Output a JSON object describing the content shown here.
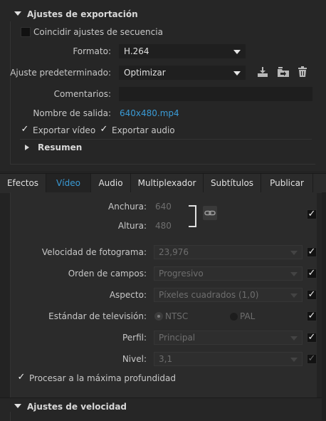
{
  "export_settings": {
    "section_title": "Ajustes de exportación",
    "match_sequence_label": "Coincidir ajustes de secuencia",
    "format_label": "Formato:",
    "format_value": "H.264",
    "preset_label": "Ajuste predeterminado:",
    "preset_value": "Optimizar",
    "comments_label": "Comentarios:",
    "comments_value": "",
    "output_name_label": "Nombre de salida:",
    "output_name_value": "640x480.mp4",
    "export_video_label": "Exportar vídeo",
    "export_audio_label": "Exportar audio",
    "summary_label": "Resumen"
  },
  "tabs": [
    {
      "label": "Efectos"
    },
    {
      "label": "Vídeo"
    },
    {
      "label": "Audio"
    },
    {
      "label": "Multiplexador"
    },
    {
      "label": "Subtítulos"
    },
    {
      "label": "Publicar"
    }
  ],
  "active_tab": "Vídeo",
  "video": {
    "width_label": "Anchura:",
    "width_value": "640",
    "height_label": "Altura:",
    "height_value": "480",
    "frame_rate_label": "Velocidad de fotograma:",
    "frame_rate_value": "23,976",
    "field_order_label": "Orden de campos:",
    "field_order_value": "Progresivo",
    "aspect_label": "Aspecto:",
    "aspect_value": "Píxeles cuadrados (1,0)",
    "tv_standard_label": "Estándar de televisión:",
    "tv_ntsc": "NTSC",
    "tv_pal": "PAL",
    "tv_selected": "NTSC",
    "profile_label": "Perfil:",
    "profile_value": "Principal",
    "level_label": "Nivel:",
    "level_value": "3,1",
    "max_depth_label": "Procesar a la máxima profundidad"
  },
  "speed_settings": {
    "section_title": "Ajustes de velocidad"
  },
  "icons": {
    "save_preset": "save-preset-icon",
    "import_preset": "import-preset-icon",
    "delete_preset": "trash-icon",
    "link": "link-icon"
  },
  "colors": {
    "accent": "#3a9bd6",
    "background": "#232323",
    "panel": "#2b2b2b"
  }
}
